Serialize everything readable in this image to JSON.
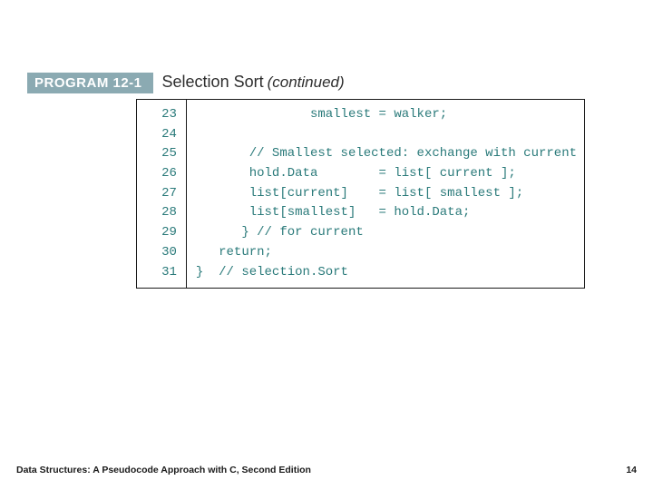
{
  "header": {
    "label": "PROGRAM 12-1",
    "title": "Selection Sort",
    "continued": "(continued)"
  },
  "code": {
    "line_start": 23,
    "lines": [
      "               smallest = walker;",
      "",
      "       // Smallest selected: exchange with current",
      "       hold.Data        = list[ current ];",
      "       list[current]    = list[ smallest ];",
      "       list[smallest]   = hold.Data;",
      "      } // for current",
      "   return;",
      "}  // selection.Sort"
    ]
  },
  "footer": {
    "text": "Data Structures: A Pseudocode Approach with C, Second Edition",
    "page": "14"
  },
  "chart_data": {
    "type": "table",
    "title": "PROGRAM 12-1 Selection Sort (continued)",
    "columns": [
      "line_number",
      "code"
    ],
    "rows": [
      [
        23,
        "               smallest = walker;"
      ],
      [
        24,
        ""
      ],
      [
        25,
        "       // Smallest selected: exchange with current"
      ],
      [
        26,
        "       hold.Data        = list[ current ];"
      ],
      [
        27,
        "       list[current]    = list[ smallest ];"
      ],
      [
        28,
        "       list[smallest]   = hold.Data;"
      ],
      [
        29,
        "      } // for current"
      ],
      [
        30,
        "   return;"
      ],
      [
        31,
        "}  // selection.Sort"
      ]
    ]
  }
}
